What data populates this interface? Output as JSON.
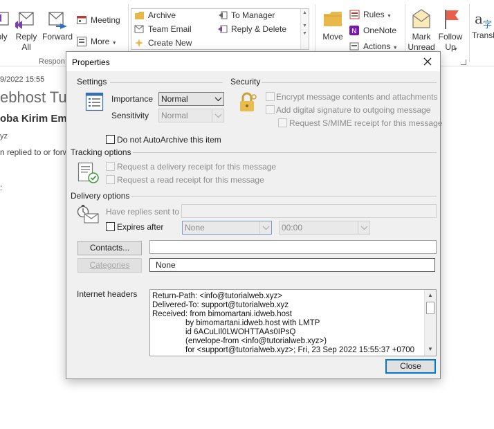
{
  "ribbon": {
    "reply_partial": "ply",
    "reply_all": "Reply\nAll",
    "forward": "Forward",
    "meeting": "Meeting",
    "more": "More",
    "respond_group_partial": "Respon",
    "quick_steps": [
      "Archive",
      "To Manager",
      "Team Email",
      "Reply & Delete",
      "Create New"
    ],
    "move": "Move",
    "rules": "Rules",
    "onenote": "OneNote",
    "actions": "Actions",
    "mark_unread": "Mark\nUnread",
    "follow_up": "Follow\nUp",
    "translate_partial": "Transl"
  },
  "email": {
    "date_partial": "9/2022 15:55",
    "subject_partial": "ebhost Tuto",
    "sender_partial": "oba Kirim Ema",
    "address_partial": "yz",
    "info_partial": "n replied to or forw",
    "tick": ":"
  },
  "dialog": {
    "title": "Properties",
    "settings": {
      "heading": "Settings",
      "importance_label": "Importance",
      "importance_value": "Normal",
      "sensitivity_label": "Sensitivity",
      "sensitivity_value": "Normal",
      "autoarchive_label": "Do not AutoArchive this item"
    },
    "security": {
      "heading": "Security",
      "encrypt_label": "Encrypt message contents and attachments",
      "signature_label": "Add digital signature to outgoing message",
      "smime_label": "Request S/MIME receipt for this message"
    },
    "tracking": {
      "heading": "Tracking options",
      "delivery_receipt_label": "Request a delivery receipt for this message",
      "read_receipt_label": "Request a read receipt for this message"
    },
    "delivery": {
      "heading": "Delivery options",
      "replies_label": "Have replies sent to",
      "expires_label": "Expires after",
      "expires_date": "None",
      "expires_time": "00:00"
    },
    "contacts_button": "Contacts...",
    "categories_button": "Categories",
    "categories_value": "None",
    "internet_headers_label": "Internet headers",
    "internet_headers": [
      "Return-Path: <info@tutorialweb.xyz>",
      "Delivered-To: support@tutorialweb.xyz",
      "Received: from bimomartani.idweb.host",
      "by bimomartani.idweb.host with LMTP",
      "id 6ACuLIl0LWOHTTAAs0IPsQ",
      "(envelope-from <info@tutorialweb.xyz>)",
      "for <support@tutorialweb.xyz>; Fri, 23 Sep 2022 15:55:37 +0700"
    ],
    "close_button": "Close"
  }
}
